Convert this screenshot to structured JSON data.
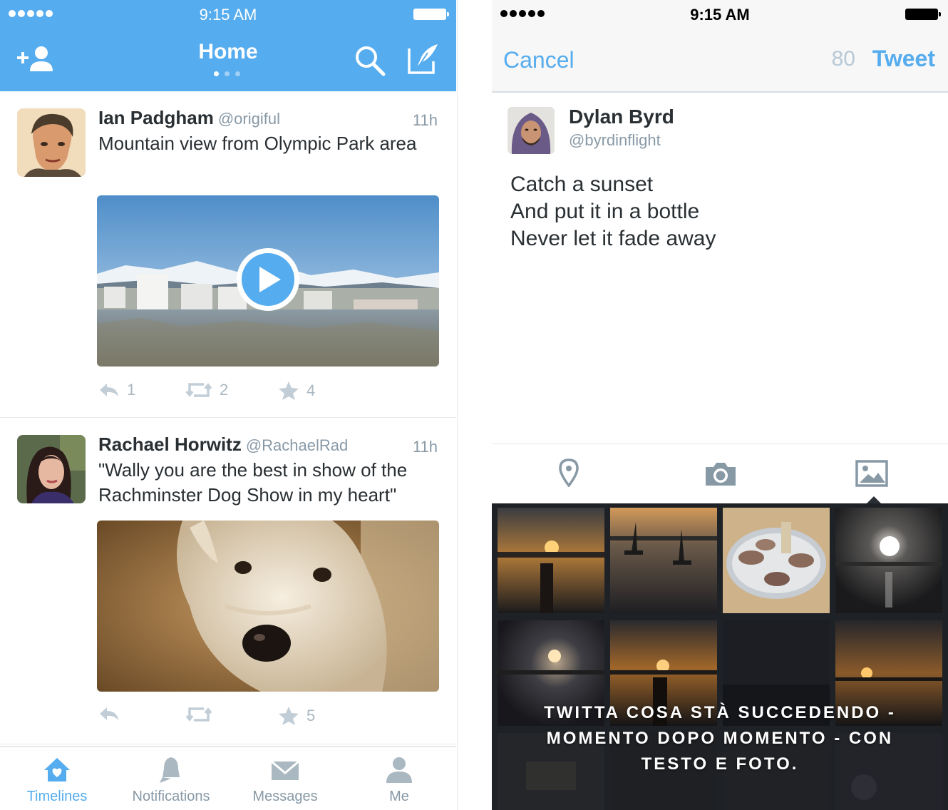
{
  "left": {
    "status": {
      "time": "9:15 AM"
    },
    "nav": {
      "title": "Home"
    },
    "tweets": [
      {
        "name": "Ian Padgham",
        "handle": "@origiful",
        "time": "11h",
        "text": "Mountain view from Olympic Park area",
        "reply_count": "1",
        "retweet_count": "2",
        "favorite_count": "4"
      },
      {
        "name": "Rachael Horwitz",
        "handle": "@RachaelRad",
        "time": "11h",
        "text": "\"Wally you are the best in show of the Rachminster Dog Show in my heart\"",
        "reply_count": "",
        "retweet_count": "",
        "favorite_count": "5"
      }
    ],
    "tabs": [
      {
        "label": "Timelines"
      },
      {
        "label": "Notifications"
      },
      {
        "label": "Messages"
      },
      {
        "label": "Me"
      }
    ]
  },
  "right": {
    "status": {
      "time": "9:15 AM"
    },
    "header": {
      "cancel": "Cancel",
      "counter": "80",
      "tweet": "Tweet"
    },
    "user": {
      "name": "Dylan Byrd",
      "handle": "@byrdinflight"
    },
    "compose_lines": [
      "Catch a sunset",
      "And put it in a bottle",
      "Never let it fade away"
    ],
    "promo_lines": [
      "TWITTA COSA STÀ SUCCEDENDO -",
      "MOMENTO DOPO MOMENTO - CON",
      "TESTO E FOTO."
    ]
  },
  "colors": {
    "accent": "#55acee",
    "text": "#292f33",
    "muted": "#8899a6",
    "icon_gray": "#aab8c2"
  },
  "icons": [
    "add-user-icon",
    "search-icon",
    "compose-icon",
    "play-icon",
    "reply-icon",
    "retweet-icon",
    "star-icon",
    "home-icon",
    "bell-icon",
    "envelope-icon",
    "person-icon",
    "location-pin-icon",
    "camera-icon",
    "photo-gallery-icon"
  ]
}
